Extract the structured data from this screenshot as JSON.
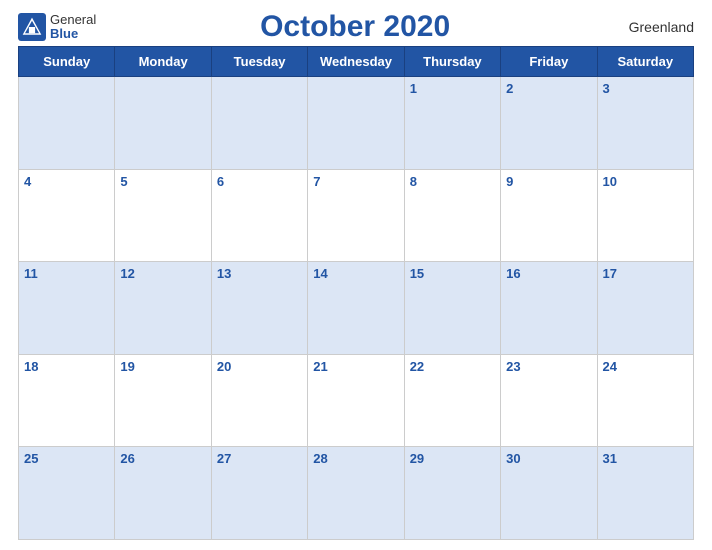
{
  "header": {
    "logo_general": "General",
    "logo_blue": "Blue",
    "title": "October 2020",
    "region": "Greenland"
  },
  "weekdays": [
    "Sunday",
    "Monday",
    "Tuesday",
    "Wednesday",
    "Thursday",
    "Friday",
    "Saturday"
  ],
  "weeks": [
    [
      "",
      "",
      "",
      "",
      "1",
      "2",
      "3"
    ],
    [
      "4",
      "5",
      "6",
      "7",
      "8",
      "9",
      "10"
    ],
    [
      "11",
      "12",
      "13",
      "14",
      "15",
      "16",
      "17"
    ],
    [
      "18",
      "19",
      "20",
      "21",
      "22",
      "23",
      "24"
    ],
    [
      "25",
      "26",
      "27",
      "28",
      "29",
      "30",
      "31"
    ]
  ]
}
